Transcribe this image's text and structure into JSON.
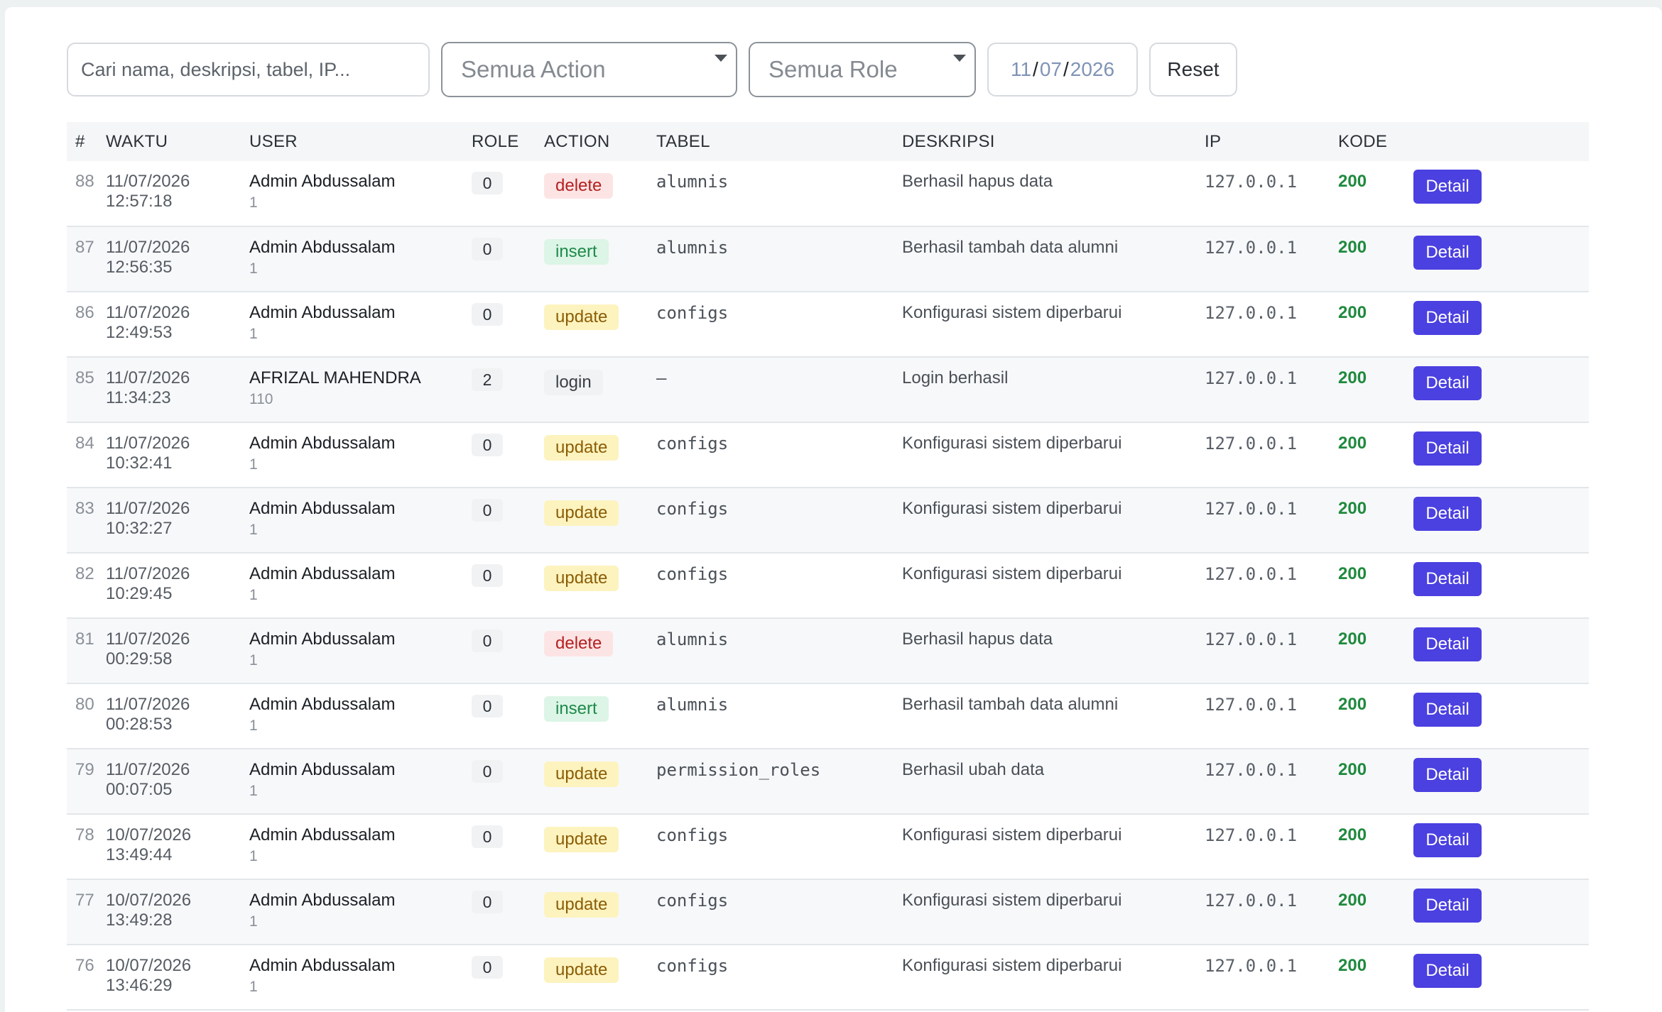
{
  "filters": {
    "search_placeholder": "Cari nama, deskripsi, tabel, IP...",
    "action_select": "Semua Action",
    "role_select": "Semua Role",
    "date": {
      "day": "11",
      "month": "07",
      "year": "2026"
    },
    "reset_label": "Reset"
  },
  "table": {
    "headers": [
      "#",
      "WAKTU",
      "USER",
      "ROLE",
      "ACTION",
      "TABEL",
      "DESKRIPSI",
      "IP",
      "KODE",
      ""
    ],
    "detail_label": "Detail",
    "rows": [
      {
        "id": "88",
        "time": "11/07/2026 12:57:18",
        "user": "Admin Abdussalam",
        "user_id": "1",
        "role": "0",
        "action": "delete",
        "table": "alumnis",
        "desc": "Berhasil hapus data",
        "ip": "127.0.0.1",
        "code": "200"
      },
      {
        "id": "87",
        "time": "11/07/2026 12:56:35",
        "user": "Admin Abdussalam",
        "user_id": "1",
        "role": "0",
        "action": "insert",
        "table": "alumnis",
        "desc": "Berhasil tambah data alumni",
        "ip": "127.0.0.1",
        "code": "200"
      },
      {
        "id": "86",
        "time": "11/07/2026 12:49:53",
        "user": "Admin Abdussalam",
        "user_id": "1",
        "role": "0",
        "action": "update",
        "table": "configs",
        "desc": "Konfigurasi sistem diperbarui",
        "ip": "127.0.0.1",
        "code": "200"
      },
      {
        "id": "85",
        "time": "11/07/2026 11:34:23",
        "user": "AFRIZAL MAHENDRA",
        "user_id": "110",
        "role": "2",
        "action": "login",
        "table": "–",
        "desc": "Login berhasil",
        "ip": "127.0.0.1",
        "code": "200"
      },
      {
        "id": "84",
        "time": "11/07/2026 10:32:41",
        "user": "Admin Abdussalam",
        "user_id": "1",
        "role": "0",
        "action": "update",
        "table": "configs",
        "desc": "Konfigurasi sistem diperbarui",
        "ip": "127.0.0.1",
        "code": "200"
      },
      {
        "id": "83",
        "time": "11/07/2026 10:32:27",
        "user": "Admin Abdussalam",
        "user_id": "1",
        "role": "0",
        "action": "update",
        "table": "configs",
        "desc": "Konfigurasi sistem diperbarui",
        "ip": "127.0.0.1",
        "code": "200"
      },
      {
        "id": "82",
        "time": "11/07/2026 10:29:45",
        "user": "Admin Abdussalam",
        "user_id": "1",
        "role": "0",
        "action": "update",
        "table": "configs",
        "desc": "Konfigurasi sistem diperbarui",
        "ip": "127.0.0.1",
        "code": "200"
      },
      {
        "id": "81",
        "time": "11/07/2026 00:29:58",
        "user": "Admin Abdussalam",
        "user_id": "1",
        "role": "0",
        "action": "delete",
        "table": "alumnis",
        "desc": "Berhasil hapus data",
        "ip": "127.0.0.1",
        "code": "200"
      },
      {
        "id": "80",
        "time": "11/07/2026 00:28:53",
        "user": "Admin Abdussalam",
        "user_id": "1",
        "role": "0",
        "action": "insert",
        "table": "alumnis",
        "desc": "Berhasil tambah data alumni",
        "ip": "127.0.0.1",
        "code": "200"
      },
      {
        "id": "79",
        "time": "11/07/2026 00:07:05",
        "user": "Admin Abdussalam",
        "user_id": "1",
        "role": "0",
        "action": "update",
        "table": "permission_roles",
        "desc": "Berhasil ubah data",
        "ip": "127.0.0.1",
        "code": "200"
      },
      {
        "id": "78",
        "time": "10/07/2026 13:49:44",
        "user": "Admin Abdussalam",
        "user_id": "1",
        "role": "0",
        "action": "update",
        "table": "configs",
        "desc": "Konfigurasi sistem diperbarui",
        "ip": "127.0.0.1",
        "code": "200"
      },
      {
        "id": "77",
        "time": "10/07/2026 13:49:28",
        "user": "Admin Abdussalam",
        "user_id": "1",
        "role": "0",
        "action": "update",
        "table": "configs",
        "desc": "Konfigurasi sistem diperbarui",
        "ip": "127.0.0.1",
        "code": "200"
      },
      {
        "id": "76",
        "time": "10/07/2026 13:46:29",
        "user": "Admin Abdussalam",
        "user_id": "1",
        "role": "0",
        "action": "update",
        "table": "configs",
        "desc": "Konfigurasi sistem diperbarui",
        "ip": "127.0.0.1",
        "code": "200"
      }
    ]
  }
}
